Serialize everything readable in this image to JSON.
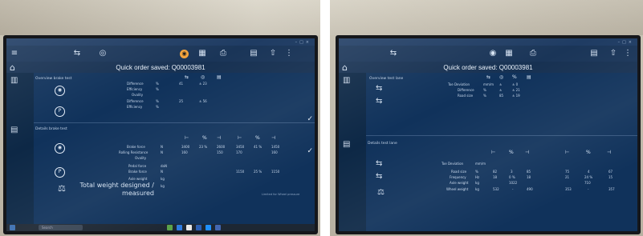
{
  "app": {
    "order_title_left": "Quick order saved: Q00003981",
    "order_title_right": "Quick order saved: Q00003981"
  },
  "left": {
    "overview_label": "Overview brake test",
    "detail_label": "Details brake test",
    "overview_rows": [
      {
        "label": "Difference",
        "unit": "%",
        "v1": "41",
        "v2": "± 23"
      },
      {
        "label": "Efficiency",
        "unit": "%",
        "v1": "",
        "v2": ""
      },
      {
        "label": "Ovality",
        "unit": "",
        "v1": "",
        "v2": ""
      },
      {
        "label": "Difference",
        "unit": "%",
        "v1": "25",
        "v2": "± 56"
      },
      {
        "label": "Efficiency",
        "unit": "%",
        "v1": "",
        "v2": ""
      }
    ],
    "detail_rows": [
      {
        "label": "Brake force",
        "unit": "N",
        "vals": [
          "3400",
          "23 %",
          "2600",
          "3450",
          "41 %",
          "1450"
        ]
      },
      {
        "label": "Rolling Resistance",
        "unit": "N",
        "vals": [
          "160",
          "",
          "150",
          "170",
          "",
          "160"
        ]
      },
      {
        "label": "Ovality",
        "unit": "",
        "vals": [
          "",
          "",
          "",
          "",
          "",
          ""
        ]
      },
      {
        "label": "Pedal force",
        "unit": "daN",
        "vals": [
          "",
          "",
          "",
          "",
          "",
          ""
        ]
      },
      {
        "label": "Brake force",
        "unit": "N",
        "vals": [
          "",
          "",
          "",
          "1150",
          "25 %",
          "1150"
        ]
      },
      {
        "label": "Axle weight",
        "unit": "kg",
        "vals": [
          "",
          "",
          "",
          "",
          "",
          ""
        ]
      }
    ],
    "total_weight_label": "Total weight designed / measured",
    "total_weight_unit": "kg",
    "footnote": "Limited for Wheel pressure"
  },
  "right": {
    "overview_label": "Overview test lane",
    "detail_label": "Details test lane",
    "overview_rows": [
      {
        "label": "Toe Deviation",
        "unit": "mm/m",
        "v1": "±",
        "v2": "± 0"
      },
      {
        "label": "Difference",
        "unit": "%",
        "v1": "±",
        "v2": "± 21"
      },
      {
        "label": "Road size",
        "unit": "%",
        "v1": "85",
        "v2": "± 19"
      }
    ],
    "detail_rows": [
      {
        "label": "Toe Deviation",
        "unit": "mm/m",
        "vals": [
          "",
          "",
          "",
          "",
          "",
          ""
        ]
      },
      {
        "label": "Road size",
        "unit": "%",
        "vals": [
          "82",
          "3",
          "85",
          "75",
          "4",
          "67"
        ]
      },
      {
        "label": "Frequency",
        "unit": "Hz",
        "vals": [
          "18",
          "0 %",
          "18",
          "21",
          "24 %",
          "15"
        ]
      },
      {
        "label": "Axle weight",
        "unit": "kg",
        "vals": [
          "",
          "1022",
          "",
          "",
          "710",
          ""
        ]
      },
      {
        "label": "Wheel weight",
        "unit": "kg",
        "vals": [
          "532",
          "-",
          "490",
          "353",
          "-",
          "357"
        ]
      }
    ]
  },
  "taskbar": {
    "search_placeholder": "Search"
  },
  "colors": {
    "screen_bg": "#10325b",
    "accent": "#f2a23a"
  }
}
